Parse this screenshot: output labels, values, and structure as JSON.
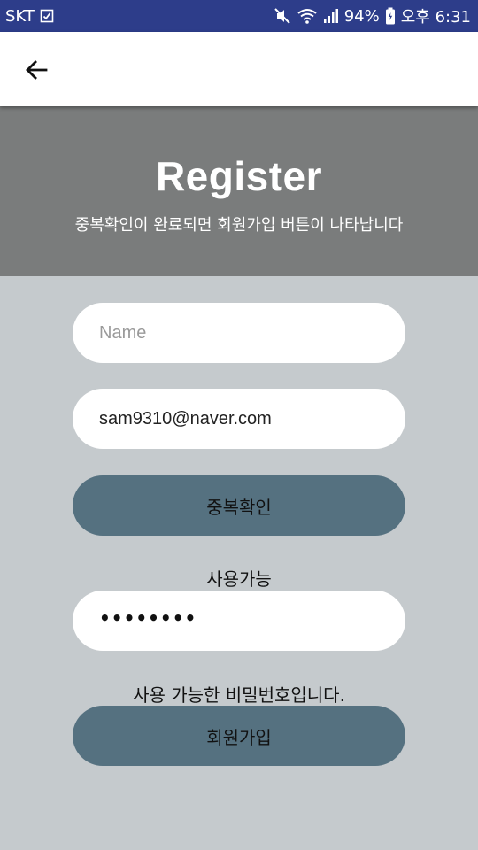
{
  "status_bar": {
    "carrier": "SKT",
    "battery": "94%",
    "time": "오후 6:31"
  },
  "header": {
    "title": "Register",
    "subtitle": "중복확인이 완료되면 회원가입 버튼이 나타납니다"
  },
  "form": {
    "name_placeholder": "Name",
    "email_value": "sam9310@naver.com",
    "check_button_label": "중복확인",
    "email_status": "사용가능",
    "password_masked": "••••••••",
    "password_status": "사용 가능한 비밀번호입니다.",
    "register_button_label": "회원가입"
  },
  "colors": {
    "status_bar": "#2d3d8a",
    "header_bg": "#7a7c7c",
    "page_bg": "#c5cacd",
    "button_bg": "#557180"
  },
  "icons": [
    "check-box-icon",
    "mute-icon",
    "wifi-icon",
    "signal-icon",
    "battery-icon",
    "back-arrow-icon"
  ]
}
